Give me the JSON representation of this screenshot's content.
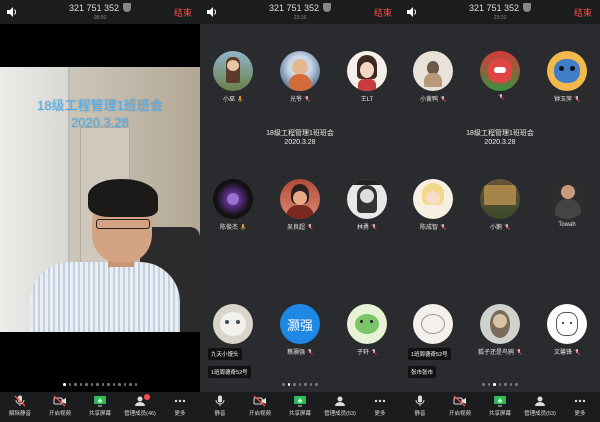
{
  "meeting": {
    "id": "321 751 352",
    "end_label": "结束",
    "title_line1": "18级工程管理1班班会",
    "title_line2": "2020.3.28"
  },
  "panels": [
    {
      "time": "08:50",
      "toolbar": [
        {
          "label": "解除静音",
          "icon": "mic-off-icon"
        },
        {
          "label": "开启视频",
          "icon": "camera-off-icon"
        },
        {
          "label": "共享屏幕",
          "icon": "share-screen-icon"
        },
        {
          "label": "管理成员(46)",
          "icon": "members-icon"
        },
        {
          "label": "更多",
          "icon": "more-icon"
        }
      ]
    },
    {
      "time": "23:16",
      "participants": [
        "小巫",
        "光爷",
        "王LT",
        "陈俊杰",
        "吴良超",
        "林勇",
        "",
        "蔡灏强",
        "子轩"
      ],
      "overlay_tags": [
        "九天小馒头",
        "1班周德奇52号"
      ],
      "toolbar": [
        {
          "label": "静音",
          "icon": "mic-icon"
        },
        {
          "label": "开启视频",
          "icon": "camera-off-icon"
        },
        {
          "label": "共享屏幕",
          "icon": "share-screen-icon"
        },
        {
          "label": "管理成员(53)",
          "icon": "members-icon"
        },
        {
          "label": "更多",
          "icon": "more-icon"
        }
      ]
    },
    {
      "time": "23:20",
      "participants": [
        "小黄鸭",
        "",
        "钟玉萍",
        "陈成智",
        "小鹅",
        "Towah",
        "",
        "狐子还是鸟鸦",
        "文馨锋"
      ],
      "overlay_tags": [
        "1班周德奇52号",
        "张市张市"
      ],
      "toolbar": [
        {
          "label": "静音",
          "icon": "mic-icon"
        },
        {
          "label": "开启视频",
          "icon": "camera-off-icon"
        },
        {
          "label": "共享屏幕",
          "icon": "share-screen-icon"
        },
        {
          "label": "管理成员(53)",
          "icon": "members-icon"
        },
        {
          "label": "更多",
          "icon": "more-icon"
        }
      ]
    }
  ],
  "avatar_text": "灏强",
  "colors": {
    "end": "#ff4d4d",
    "video_title": "#47aef2",
    "share_green": "#2dbf5a"
  }
}
